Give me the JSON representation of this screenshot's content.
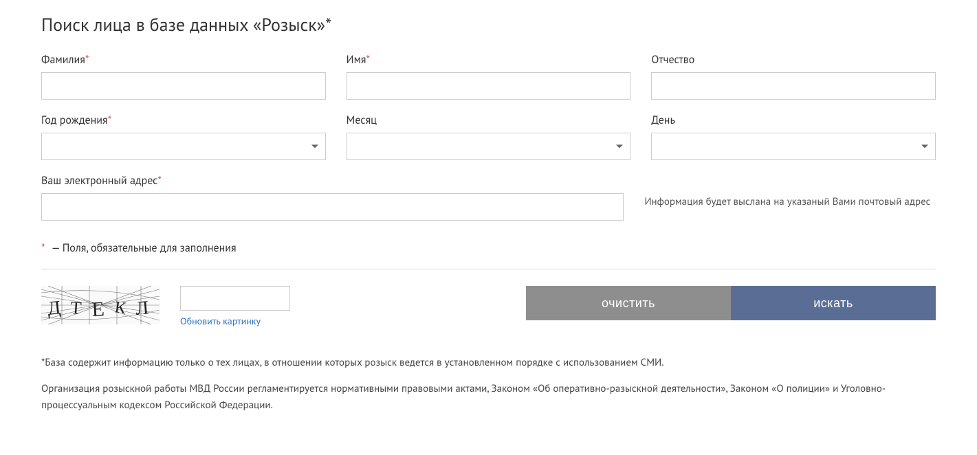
{
  "title": "Поиск лица в базе данных «Розыск»*",
  "fields": {
    "surname": {
      "label": "Фамилия",
      "required": true
    },
    "name": {
      "label": "Имя",
      "required": true
    },
    "patronymic": {
      "label": "Отчество",
      "required": false
    },
    "birth_year": {
      "label": "Год рождения",
      "required": true
    },
    "month": {
      "label": "Месяц",
      "required": false
    },
    "day": {
      "label": "День",
      "required": false
    },
    "email": {
      "label": "Ваш электронный адрес",
      "required": true
    }
  },
  "email_note": "Информация будет выслана на указаный Вами почтовый адрес",
  "required_note": "— Поля, обязательные для заполнения",
  "required_marker": "*",
  "captcha": {
    "text": "ДТЕКЛ",
    "refresh": "Обновить картинку"
  },
  "buttons": {
    "clear": "очистить",
    "search": "искать"
  },
  "footnotes": {
    "p1": "*База содержит информацию только о тех лицах, в отношении которых розыск ведется в установленном порядке с использованием СМИ.",
    "p2": "Организация розыскной работы МВД России регламентируется нормативными правовыми актами, Законом «Об оперативно-разыскной деятельности», Законом «О полиции» и Уголовно-процессуальным кодексом Российской Федерации."
  }
}
